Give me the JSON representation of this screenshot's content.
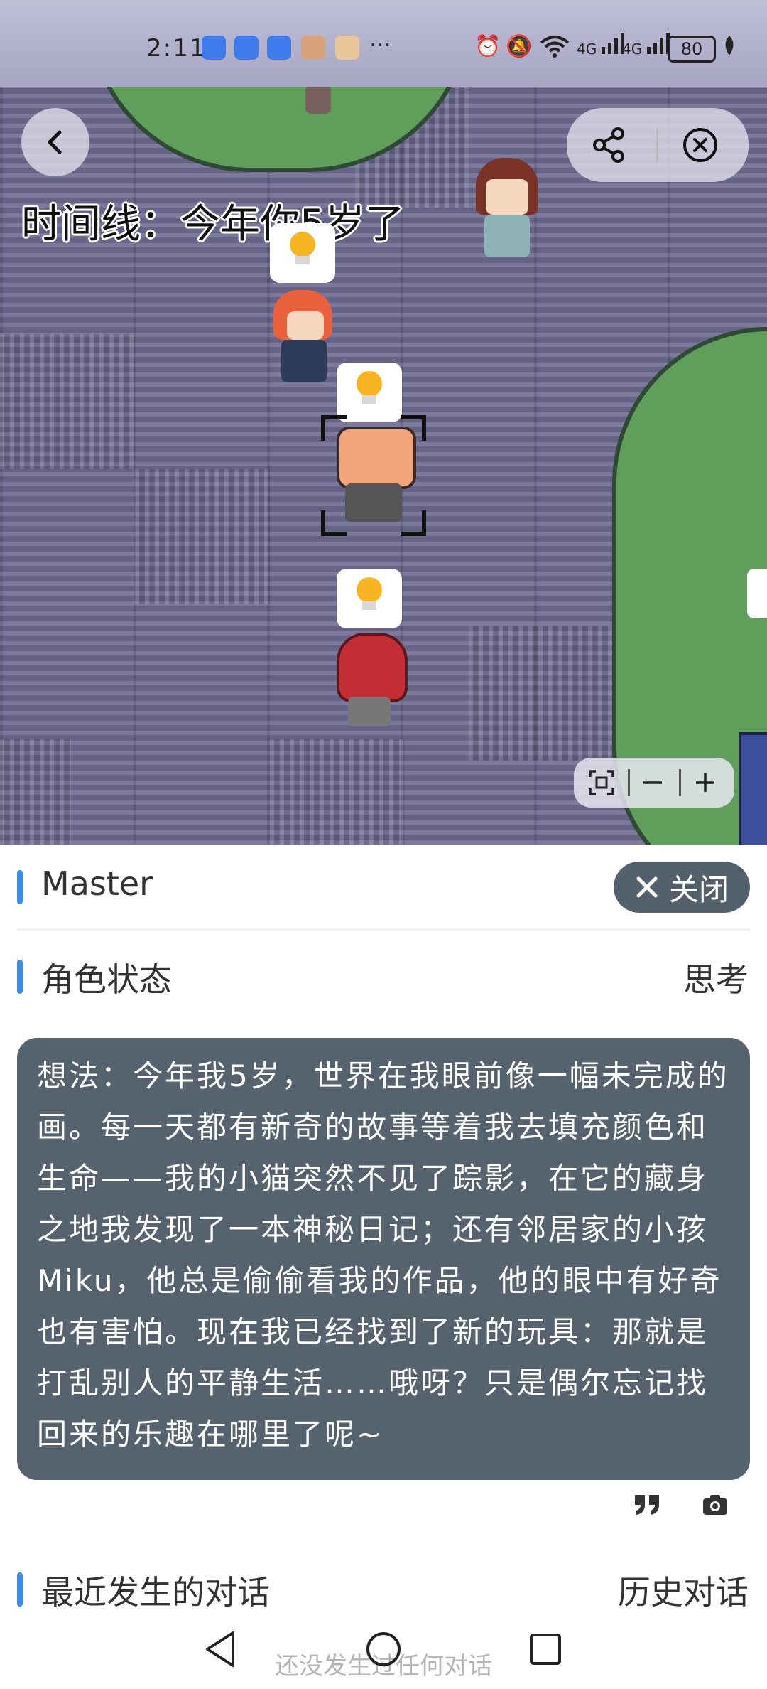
{
  "status_bar": {
    "time": "2:11",
    "battery": "80",
    "signal_1": "4G",
    "signal_2": "4G"
  },
  "map": {
    "timeline_label": "时间线：今年你5岁了"
  },
  "panel": {
    "character_name": "Master",
    "close_button_label": "关闭",
    "status_section_title": "角色状态",
    "status_value": "思考",
    "thought_text": "想法：今年我5岁，世界在我眼前像一幅未完成的画。每一天都有新奇的故事等着我去填充颜色和生命——我的小猫突然不见了踪影，在它的藏身之地我发现了一本神秘日记；还有邻居家的小孩Miku，他总是偷偷看我的作品，他的眼中有好奇也有害怕。现在我已经找到了新的玩具：那就是打乱别人的平静生活……哦呀？只是偶尔忘记找回来的乐趣在哪里了呢~",
    "recent_section_title": "最近发生的对话",
    "history_link": "历史对话",
    "empty_conversation_text": "还没发生过任何对话"
  },
  "colors": {
    "accent_blue": "#3d8be8",
    "panel_dark": "#56636e",
    "map_floor": "#6d6a90",
    "tree_green": "#5f9e5b"
  }
}
